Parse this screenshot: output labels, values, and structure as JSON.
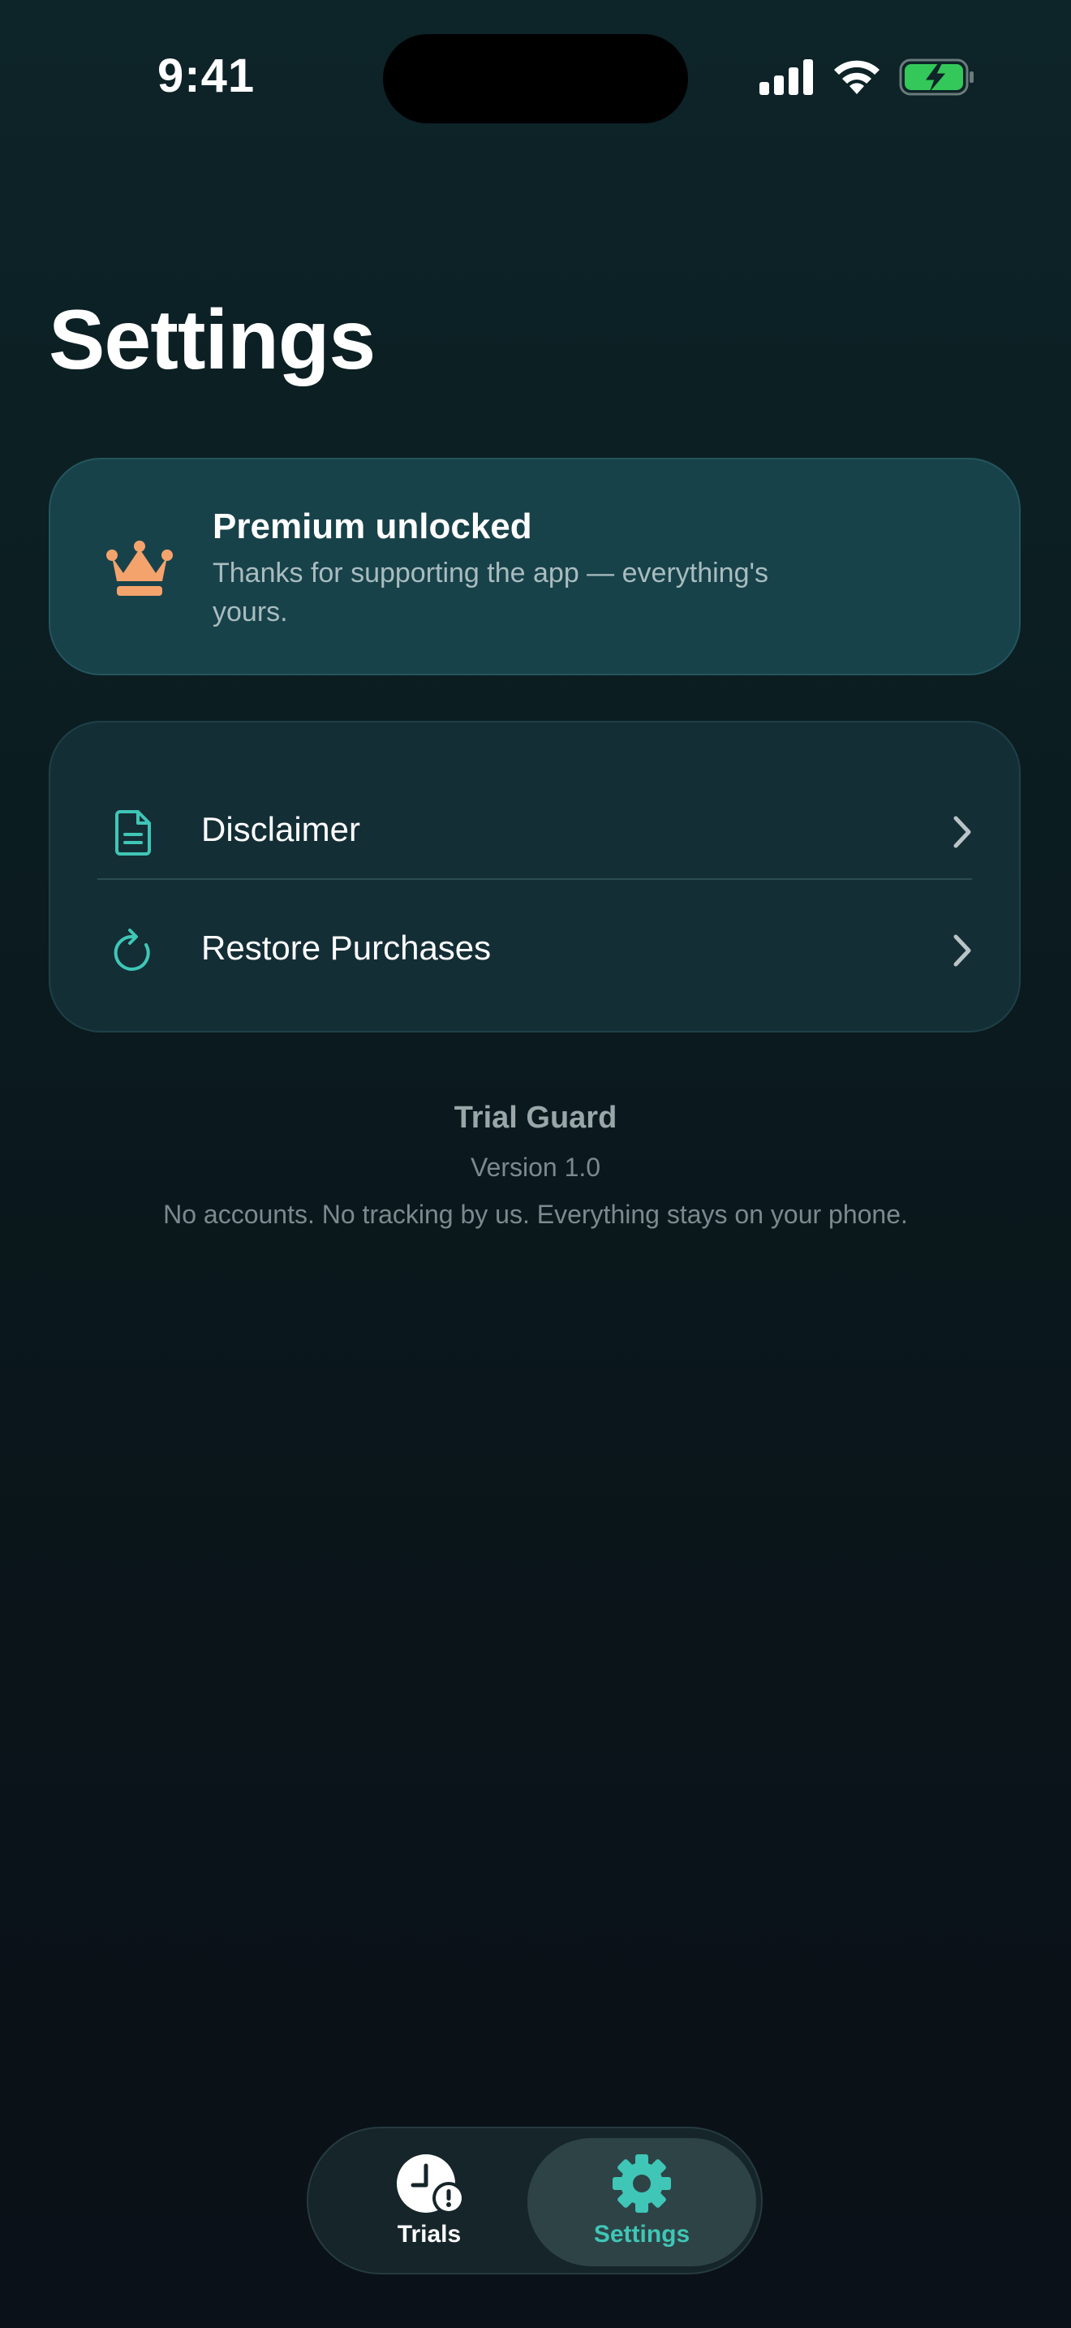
{
  "status_bar": {
    "time": "9:41"
  },
  "page": {
    "title": "Settings"
  },
  "premium": {
    "title": "Premium unlocked",
    "subtitle": "Thanks for supporting the app — everything's yours.",
    "icon": "crown-icon"
  },
  "menu": {
    "items": [
      {
        "label": "Disclaimer",
        "icon": "document-icon"
      },
      {
        "label": "Restore Purchases",
        "icon": "refresh-icon"
      }
    ]
  },
  "app_info": {
    "name": "Trial Guard",
    "version": "Version 1.0",
    "tagline": "No accounts. No tracking by us. Everything stays on your phone."
  },
  "tab_bar": {
    "tabs": [
      {
        "label": "Trials",
        "icon": "clock-alert-icon",
        "active": false
      },
      {
        "label": "Settings",
        "icon": "gear-icon",
        "active": true
      }
    ]
  },
  "colors": {
    "accent": "#3fc6b6",
    "crown": "#f5a36c",
    "battery": "#34c759"
  }
}
